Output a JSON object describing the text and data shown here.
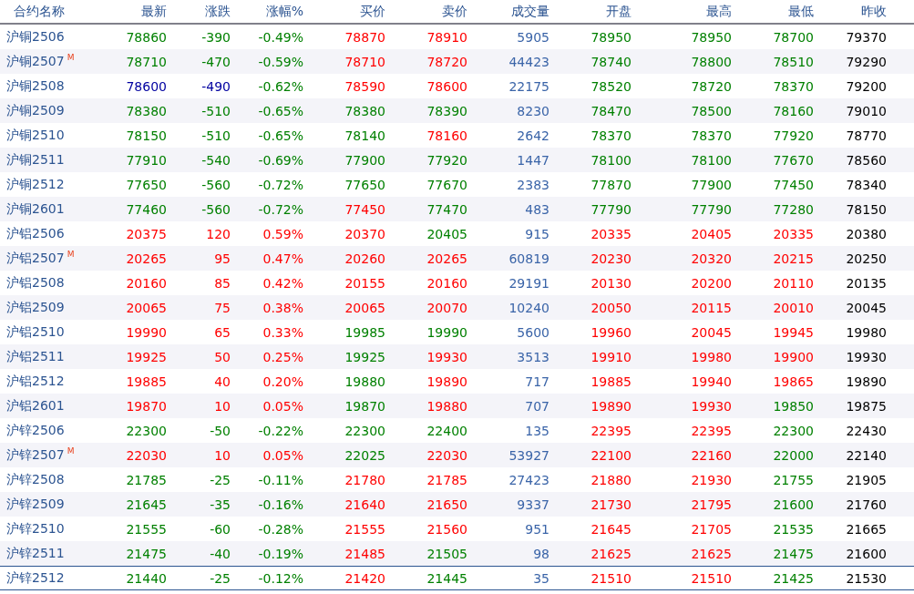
{
  "table": {
    "name_column": "合约名称",
    "columns": [
      "最新",
      "涨跌",
      "涨幅%",
      "买价",
      "卖价",
      "成交量",
      "开盘",
      "最高",
      "最低",
      "昨收"
    ],
    "rows": [
      {
        "name": "沪铜2506",
        "selected": false,
        "cells": [
          {
            "text": "78860",
            "color": "#008000"
          },
          {
            "text": "-390",
            "color": "#008000"
          },
          {
            "text": "-0.49%",
            "color": "#008000"
          },
          {
            "text": "78870",
            "color": "#ff0000"
          },
          {
            "text": "78910",
            "color": "#ff0000"
          },
          {
            "text": "5905",
            "color": "#3a64a8"
          },
          {
            "text": "78950",
            "color": "#008000"
          },
          {
            "text": "78950",
            "color": "#008000"
          },
          {
            "text": "78700",
            "color": "#008000"
          },
          {
            "text": "79370",
            "color": "#000000"
          }
        ]
      },
      {
        "name": "沪铜2507",
        "badge": "M",
        "selected": false,
        "cells": [
          {
            "text": "78710",
            "color": "#008000"
          },
          {
            "text": "-470",
            "color": "#008000"
          },
          {
            "text": "-0.59%",
            "color": "#008000"
          },
          {
            "text": "78710",
            "color": "#ff0000"
          },
          {
            "text": "78720",
            "color": "#ff0000"
          },
          {
            "text": "44423",
            "color": "#3a64a8"
          },
          {
            "text": "78740",
            "color": "#008000"
          },
          {
            "text": "78800",
            "color": "#008000"
          },
          {
            "text": "78510",
            "color": "#008000"
          },
          {
            "text": "79290",
            "color": "#000000"
          }
        ]
      },
      {
        "name": "沪铜2508",
        "selected": false,
        "cells": [
          {
            "text": "78600",
            "color": "#0000a0"
          },
          {
            "text": "-490",
            "color": "#0000a0"
          },
          {
            "text": "-0.62%",
            "color": "#008000"
          },
          {
            "text": "78590",
            "color": "#ff0000"
          },
          {
            "text": "78600",
            "color": "#ff0000"
          },
          {
            "text": "22175",
            "color": "#3a64a8"
          },
          {
            "text": "78520",
            "color": "#008000"
          },
          {
            "text": "78720",
            "color": "#008000"
          },
          {
            "text": "78370",
            "color": "#008000"
          },
          {
            "text": "79200",
            "color": "#000000"
          }
        ]
      },
      {
        "name": "沪铜2509",
        "selected": false,
        "cells": [
          {
            "text": "78380",
            "color": "#008000"
          },
          {
            "text": "-510",
            "color": "#008000"
          },
          {
            "text": "-0.65%",
            "color": "#008000"
          },
          {
            "text": "78380",
            "color": "#008000"
          },
          {
            "text": "78390",
            "color": "#008000"
          },
          {
            "text": "8230",
            "color": "#3a64a8"
          },
          {
            "text": "78470",
            "color": "#008000"
          },
          {
            "text": "78500",
            "color": "#008000"
          },
          {
            "text": "78160",
            "color": "#008000"
          },
          {
            "text": "79010",
            "color": "#000000"
          }
        ]
      },
      {
        "name": "沪铜2510",
        "selected": false,
        "cells": [
          {
            "text": "78150",
            "color": "#008000"
          },
          {
            "text": "-510",
            "color": "#008000"
          },
          {
            "text": "-0.65%",
            "color": "#008000"
          },
          {
            "text": "78140",
            "color": "#008000"
          },
          {
            "text": "78160",
            "color": "#ff0000"
          },
          {
            "text": "2642",
            "color": "#3a64a8"
          },
          {
            "text": "78370",
            "color": "#008000"
          },
          {
            "text": "78370",
            "color": "#008000"
          },
          {
            "text": "77920",
            "color": "#008000"
          },
          {
            "text": "78770",
            "color": "#000000"
          }
        ]
      },
      {
        "name": "沪铜2511",
        "selected": false,
        "cells": [
          {
            "text": "77910",
            "color": "#008000"
          },
          {
            "text": "-540",
            "color": "#008000"
          },
          {
            "text": "-0.69%",
            "color": "#008000"
          },
          {
            "text": "77900",
            "color": "#008000"
          },
          {
            "text": "77920",
            "color": "#008000"
          },
          {
            "text": "1447",
            "color": "#3a64a8"
          },
          {
            "text": "78100",
            "color": "#008000"
          },
          {
            "text": "78100",
            "color": "#008000"
          },
          {
            "text": "77670",
            "color": "#008000"
          },
          {
            "text": "78560",
            "color": "#000000"
          }
        ]
      },
      {
        "name": "沪铜2512",
        "selected": false,
        "cells": [
          {
            "text": "77650",
            "color": "#008000"
          },
          {
            "text": "-560",
            "color": "#008000"
          },
          {
            "text": "-0.72%",
            "color": "#008000"
          },
          {
            "text": "77650",
            "color": "#008000"
          },
          {
            "text": "77670",
            "color": "#008000"
          },
          {
            "text": "2383",
            "color": "#3a64a8"
          },
          {
            "text": "77870",
            "color": "#008000"
          },
          {
            "text": "77900",
            "color": "#008000"
          },
          {
            "text": "77450",
            "color": "#008000"
          },
          {
            "text": "78340",
            "color": "#000000"
          }
        ]
      },
      {
        "name": "沪铜2601",
        "selected": false,
        "cells": [
          {
            "text": "77460",
            "color": "#008000"
          },
          {
            "text": "-560",
            "color": "#008000"
          },
          {
            "text": "-0.72%",
            "color": "#008000"
          },
          {
            "text": "77450",
            "color": "#ff0000"
          },
          {
            "text": "77470",
            "color": "#008000"
          },
          {
            "text": "483",
            "color": "#3a64a8"
          },
          {
            "text": "77790",
            "color": "#008000"
          },
          {
            "text": "77790",
            "color": "#008000"
          },
          {
            "text": "77280",
            "color": "#008000"
          },
          {
            "text": "78150",
            "color": "#000000"
          }
        ]
      },
      {
        "name": "沪铝2506",
        "selected": false,
        "cells": [
          {
            "text": "20375",
            "color": "#ff0000"
          },
          {
            "text": "120",
            "color": "#ff0000"
          },
          {
            "text": "0.59%",
            "color": "#ff0000"
          },
          {
            "text": "20370",
            "color": "#ff0000"
          },
          {
            "text": "20405",
            "color": "#008000"
          },
          {
            "text": "915",
            "color": "#3a64a8"
          },
          {
            "text": "20335",
            "color": "#ff0000"
          },
          {
            "text": "20405",
            "color": "#ff0000"
          },
          {
            "text": "20335",
            "color": "#ff0000"
          },
          {
            "text": "20380",
            "color": "#000000"
          }
        ]
      },
      {
        "name": "沪铝2507",
        "badge": "M",
        "selected": false,
        "cells": [
          {
            "text": "20265",
            "color": "#ff0000"
          },
          {
            "text": "95",
            "color": "#ff0000"
          },
          {
            "text": "0.47%",
            "color": "#ff0000"
          },
          {
            "text": "20260",
            "color": "#ff0000"
          },
          {
            "text": "20265",
            "color": "#ff0000"
          },
          {
            "text": "60819",
            "color": "#3a64a8"
          },
          {
            "text": "20230",
            "color": "#ff0000"
          },
          {
            "text": "20320",
            "color": "#ff0000"
          },
          {
            "text": "20215",
            "color": "#ff0000"
          },
          {
            "text": "20250",
            "color": "#000000"
          }
        ]
      },
      {
        "name": "沪铝2508",
        "selected": false,
        "cells": [
          {
            "text": "20160",
            "color": "#ff0000"
          },
          {
            "text": "85",
            "color": "#ff0000"
          },
          {
            "text": "0.42%",
            "color": "#ff0000"
          },
          {
            "text": "20155",
            "color": "#ff0000"
          },
          {
            "text": "20160",
            "color": "#ff0000"
          },
          {
            "text": "29191",
            "color": "#3a64a8"
          },
          {
            "text": "20130",
            "color": "#ff0000"
          },
          {
            "text": "20200",
            "color": "#ff0000"
          },
          {
            "text": "20110",
            "color": "#ff0000"
          },
          {
            "text": "20135",
            "color": "#000000"
          }
        ]
      },
      {
        "name": "沪铝2509",
        "selected": false,
        "cells": [
          {
            "text": "20065",
            "color": "#ff0000"
          },
          {
            "text": "75",
            "color": "#ff0000"
          },
          {
            "text": "0.38%",
            "color": "#ff0000"
          },
          {
            "text": "20065",
            "color": "#ff0000"
          },
          {
            "text": "20070",
            "color": "#ff0000"
          },
          {
            "text": "10240",
            "color": "#3a64a8"
          },
          {
            "text": "20050",
            "color": "#ff0000"
          },
          {
            "text": "20115",
            "color": "#ff0000"
          },
          {
            "text": "20010",
            "color": "#ff0000"
          },
          {
            "text": "20045",
            "color": "#000000"
          }
        ]
      },
      {
        "name": "沪铝2510",
        "selected": false,
        "cells": [
          {
            "text": "19990",
            "color": "#ff0000"
          },
          {
            "text": "65",
            "color": "#ff0000"
          },
          {
            "text": "0.33%",
            "color": "#ff0000"
          },
          {
            "text": "19985",
            "color": "#008000"
          },
          {
            "text": "19990",
            "color": "#008000"
          },
          {
            "text": "5600",
            "color": "#3a64a8"
          },
          {
            "text": "19960",
            "color": "#ff0000"
          },
          {
            "text": "20045",
            "color": "#ff0000"
          },
          {
            "text": "19945",
            "color": "#ff0000"
          },
          {
            "text": "19980",
            "color": "#000000"
          }
        ]
      },
      {
        "name": "沪铝2511",
        "selected": false,
        "cells": [
          {
            "text": "19925",
            "color": "#ff0000"
          },
          {
            "text": "50",
            "color": "#ff0000"
          },
          {
            "text": "0.25%",
            "color": "#ff0000"
          },
          {
            "text": "19925",
            "color": "#008000"
          },
          {
            "text": "19930",
            "color": "#ff0000"
          },
          {
            "text": "3513",
            "color": "#3a64a8"
          },
          {
            "text": "19910",
            "color": "#ff0000"
          },
          {
            "text": "19980",
            "color": "#ff0000"
          },
          {
            "text": "19900",
            "color": "#ff0000"
          },
          {
            "text": "19930",
            "color": "#000000"
          }
        ]
      },
      {
        "name": "沪铝2512",
        "selected": false,
        "cells": [
          {
            "text": "19885",
            "color": "#ff0000"
          },
          {
            "text": "40",
            "color": "#ff0000"
          },
          {
            "text": "0.20%",
            "color": "#ff0000"
          },
          {
            "text": "19880",
            "color": "#008000"
          },
          {
            "text": "19890",
            "color": "#ff0000"
          },
          {
            "text": "717",
            "color": "#3a64a8"
          },
          {
            "text": "19885",
            "color": "#ff0000"
          },
          {
            "text": "19940",
            "color": "#ff0000"
          },
          {
            "text": "19865",
            "color": "#ff0000"
          },
          {
            "text": "19890",
            "color": "#000000"
          }
        ]
      },
      {
        "name": "沪铝2601",
        "selected": false,
        "cells": [
          {
            "text": "19870",
            "color": "#ff0000"
          },
          {
            "text": "10",
            "color": "#ff0000"
          },
          {
            "text": "0.05%",
            "color": "#ff0000"
          },
          {
            "text": "19870",
            "color": "#008000"
          },
          {
            "text": "19880",
            "color": "#ff0000"
          },
          {
            "text": "707",
            "color": "#3a64a8"
          },
          {
            "text": "19890",
            "color": "#ff0000"
          },
          {
            "text": "19930",
            "color": "#ff0000"
          },
          {
            "text": "19850",
            "color": "#008000"
          },
          {
            "text": "19875",
            "color": "#000000"
          }
        ]
      },
      {
        "name": "沪锌2506",
        "selected": false,
        "cells": [
          {
            "text": "22300",
            "color": "#008000"
          },
          {
            "text": "-50",
            "color": "#008000"
          },
          {
            "text": "-0.22%",
            "color": "#008000"
          },
          {
            "text": "22300",
            "color": "#008000"
          },
          {
            "text": "22400",
            "color": "#008000"
          },
          {
            "text": "135",
            "color": "#3a64a8"
          },
          {
            "text": "22395",
            "color": "#ff0000"
          },
          {
            "text": "22395",
            "color": "#ff0000"
          },
          {
            "text": "22300",
            "color": "#008000"
          },
          {
            "text": "22430",
            "color": "#000000"
          }
        ]
      },
      {
        "name": "沪锌2507",
        "badge": "M",
        "selected": false,
        "cells": [
          {
            "text": "22030",
            "color": "#ff0000"
          },
          {
            "text": "10",
            "color": "#ff0000"
          },
          {
            "text": "0.05%",
            "color": "#ff0000"
          },
          {
            "text": "22025",
            "color": "#008000"
          },
          {
            "text": "22030",
            "color": "#ff0000"
          },
          {
            "text": "53927",
            "color": "#3a64a8"
          },
          {
            "text": "22100",
            "color": "#ff0000"
          },
          {
            "text": "22160",
            "color": "#ff0000"
          },
          {
            "text": "22000",
            "color": "#008000"
          },
          {
            "text": "22140",
            "color": "#000000"
          }
        ]
      },
      {
        "name": "沪锌2508",
        "selected": false,
        "cells": [
          {
            "text": "21785",
            "color": "#008000"
          },
          {
            "text": "-25",
            "color": "#008000"
          },
          {
            "text": "-0.11%",
            "color": "#008000"
          },
          {
            "text": "21780",
            "color": "#ff0000"
          },
          {
            "text": "21785",
            "color": "#ff0000"
          },
          {
            "text": "27423",
            "color": "#3a64a8"
          },
          {
            "text": "21880",
            "color": "#ff0000"
          },
          {
            "text": "21930",
            "color": "#ff0000"
          },
          {
            "text": "21755",
            "color": "#008000"
          },
          {
            "text": "21905",
            "color": "#000000"
          }
        ]
      },
      {
        "name": "沪锌2509",
        "selected": false,
        "cells": [
          {
            "text": "21645",
            "color": "#008000"
          },
          {
            "text": "-35",
            "color": "#008000"
          },
          {
            "text": "-0.16%",
            "color": "#008000"
          },
          {
            "text": "21640",
            "color": "#ff0000"
          },
          {
            "text": "21650",
            "color": "#ff0000"
          },
          {
            "text": "9337",
            "color": "#3a64a8"
          },
          {
            "text": "21730",
            "color": "#ff0000"
          },
          {
            "text": "21795",
            "color": "#ff0000"
          },
          {
            "text": "21600",
            "color": "#008000"
          },
          {
            "text": "21760",
            "color": "#000000"
          }
        ]
      },
      {
        "name": "沪锌2510",
        "selected": false,
        "cells": [
          {
            "text": "21555",
            "color": "#008000"
          },
          {
            "text": "-60",
            "color": "#008000"
          },
          {
            "text": "-0.28%",
            "color": "#008000"
          },
          {
            "text": "21555",
            "color": "#ff0000"
          },
          {
            "text": "21560",
            "color": "#ff0000"
          },
          {
            "text": "951",
            "color": "#3a64a8"
          },
          {
            "text": "21645",
            "color": "#ff0000"
          },
          {
            "text": "21705",
            "color": "#ff0000"
          },
          {
            "text": "21535",
            "color": "#008000"
          },
          {
            "text": "21665",
            "color": "#000000"
          }
        ]
      },
      {
        "name": "沪锌2511",
        "selected": false,
        "cells": [
          {
            "text": "21475",
            "color": "#008000"
          },
          {
            "text": "-40",
            "color": "#008000"
          },
          {
            "text": "-0.19%",
            "color": "#008000"
          },
          {
            "text": "21485",
            "color": "#ff0000"
          },
          {
            "text": "21505",
            "color": "#008000"
          },
          {
            "text": "98",
            "color": "#3a64a8"
          },
          {
            "text": "21625",
            "color": "#ff0000"
          },
          {
            "text": "21625",
            "color": "#ff0000"
          },
          {
            "text": "21475",
            "color": "#008000"
          },
          {
            "text": "21600",
            "color": "#000000"
          }
        ]
      },
      {
        "name": "沪锌2512",
        "selected": true,
        "cells": [
          {
            "text": "21440",
            "color": "#008000"
          },
          {
            "text": "-25",
            "color": "#008000"
          },
          {
            "text": "-0.12%",
            "color": "#008000"
          },
          {
            "text": "21420",
            "color": "#ff0000"
          },
          {
            "text": "21445",
            "color": "#008000"
          },
          {
            "text": "35",
            "color": "#3a64a8"
          },
          {
            "text": "21510",
            "color": "#ff0000"
          },
          {
            "text": "21510",
            "color": "#ff0000"
          },
          {
            "text": "21425",
            "color": "#008000"
          },
          {
            "text": "21530",
            "color": "#000000"
          }
        ]
      }
    ]
  }
}
